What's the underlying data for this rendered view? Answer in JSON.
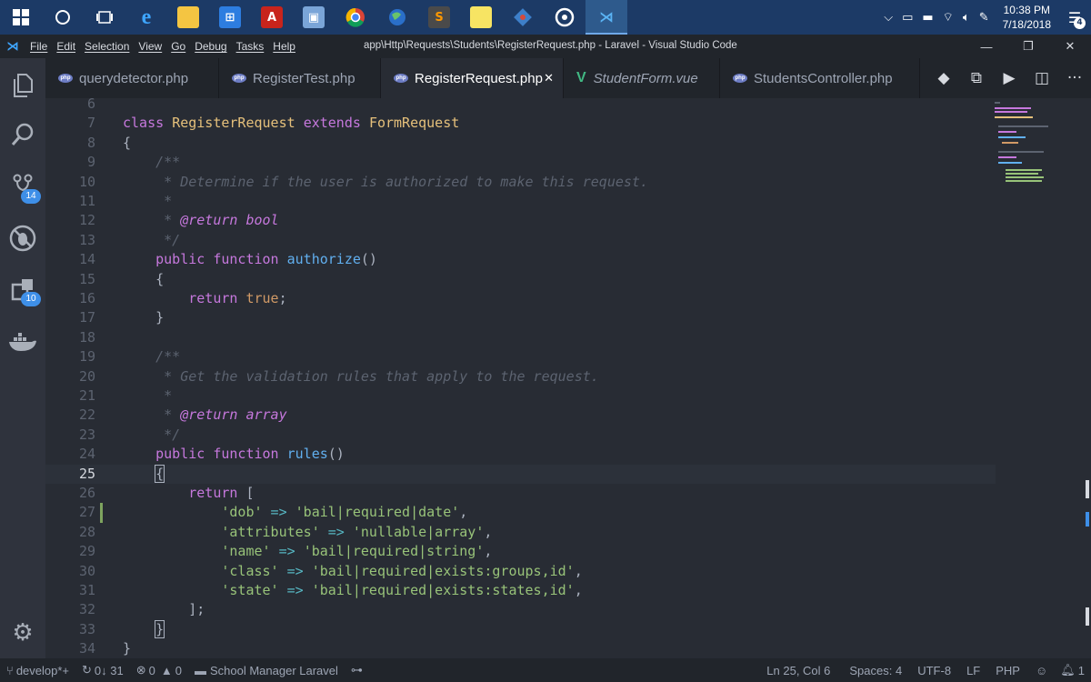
{
  "taskbar": {
    "apps": [
      "windows-start",
      "cortana",
      "task-view",
      "edge",
      "file-explorer",
      "store",
      "acrobat",
      "photos",
      "chrome",
      "vpn",
      "sublime",
      "sticky-notes",
      "git",
      "groove",
      "vscode"
    ],
    "clock_time": "10:38 PM",
    "clock_date": "7/18/2018",
    "notification_count": "4"
  },
  "window": {
    "title": "app\\Http\\Requests\\Students\\RegisterRequest.php - Laravel - Visual Studio Code",
    "menu": [
      "File",
      "Edit",
      "Selection",
      "View",
      "Go",
      "Debug",
      "Tasks",
      "Help"
    ]
  },
  "activity_bar": {
    "scm_badge": "14",
    "extensions_badge": "10"
  },
  "tabs": [
    {
      "label": "querydetector.php",
      "icon": "php-icon"
    },
    {
      "label": "RegisterTest.php",
      "icon": "php-icon"
    },
    {
      "label": "RegisterRequest.php",
      "icon": "php-icon",
      "active": true
    },
    {
      "label": "StudentForm.vue",
      "icon": "vue-icon"
    },
    {
      "label": "StudentsController.php",
      "icon": "php-icon"
    }
  ],
  "editor": {
    "line_numbers": [
      "6",
      "7",
      "8",
      "9",
      "10",
      "11",
      "12",
      "13",
      "14",
      "15",
      "16",
      "17",
      "18",
      "19",
      "20",
      "21",
      "22",
      "23",
      "24",
      "25",
      "26",
      "27",
      "28",
      "29",
      "30",
      "31",
      "32",
      "33",
      "34"
    ],
    "current_line": "25",
    "tokens": {
      "class_kw": "class",
      "class_name": "RegisterRequest",
      "extends_kw": "extends",
      "parent": "FormRequest",
      "open_brace": "{",
      "close_brace": "}",
      "doc_open": "/**",
      "doc_close": "*/",
      "doc_star": "*",
      "doc_star_sp": "* ",
      "doc_authorize": "* Determine if the user is authorized to make this request.",
      "doc_rules": "* Get the validation rules that apply to the request.",
      "return_tag": "@return",
      "type_bool": " bool",
      "type_array": " array",
      "public_kw": "public",
      "function_kw": " function ",
      "authorize": "authorize",
      "rules": "rules",
      "parens": "()",
      "return_kw": "return",
      "true_kw": "true",
      "semicolon": ";",
      "open_bracket": " [",
      "close_bracket": "];",
      "arrow": " => ",
      "comma": ","
    },
    "rules": [
      {
        "key": "'dob'",
        "value": "'bail|required|date'"
      },
      {
        "key": "'attributes'",
        "value": "'nullable|array'"
      },
      {
        "key": "'name'",
        "value": "'bail|required|string'"
      },
      {
        "key": "'class'",
        "value": "'bail|required|exists:groups,id'"
      },
      {
        "key": "'state'",
        "value": "'bail|required|exists:states,id'"
      }
    ]
  },
  "status_bar": {
    "branch": "develop*+",
    "sync": "0↓ 31",
    "errors": "0",
    "warnings": "0",
    "project": "School Manager Laravel",
    "position": "Ln 25, Col 6",
    "spaces": "Spaces: 4",
    "encoding": "UTF-8",
    "eol": "LF",
    "language": "PHP",
    "notifications": "1"
  },
  "colors": {
    "keyword": "#c678dd",
    "class": "#e5c07b",
    "function": "#61afef",
    "string": "#98c379",
    "comment": "#5c6370",
    "editor_bg": "#282c34",
    "taskbar_bg": "#1c3a66"
  }
}
